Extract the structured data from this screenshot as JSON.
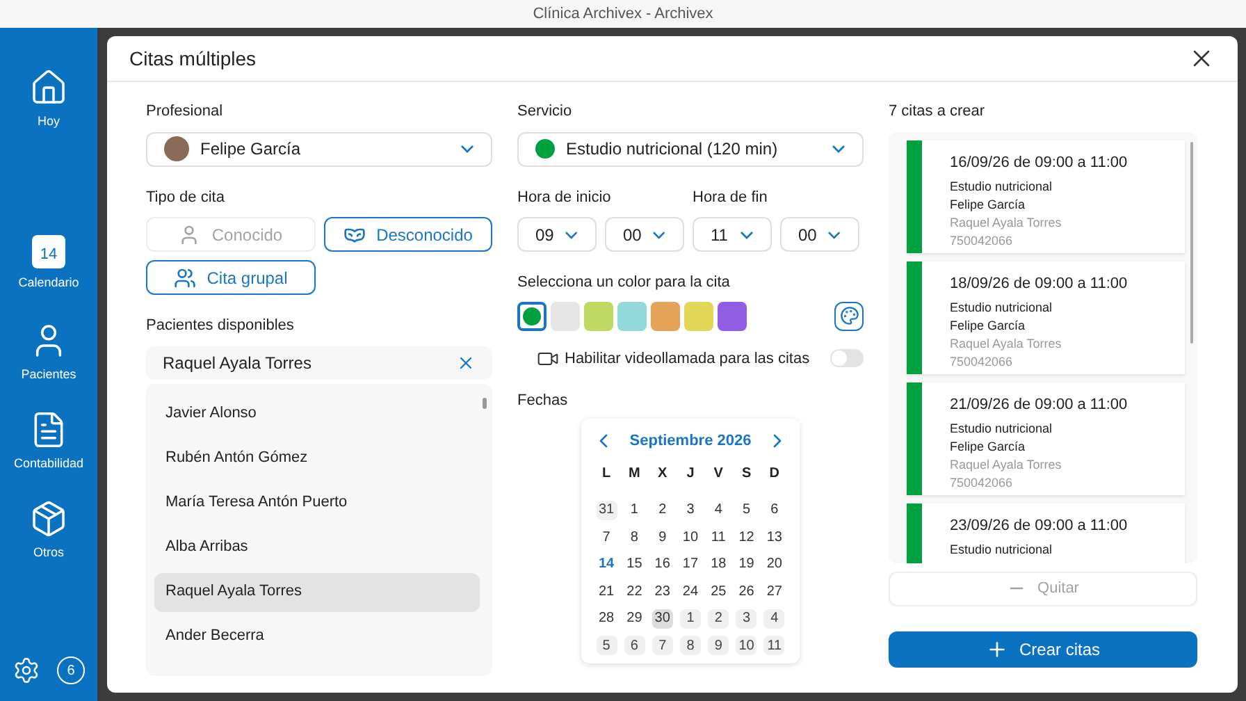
{
  "window": {
    "title": "Clínica Archivex - Archivex"
  },
  "sidebar": {
    "items": [
      {
        "label": "Hoy",
        "kind": "home"
      },
      {
        "label": "Calendario",
        "kind": "calendar",
        "icon_text": "14"
      },
      {
        "label": "Pacientes",
        "kind": "person"
      },
      {
        "label": "Contabilidad",
        "kind": "invoice"
      },
      {
        "label": "Otros",
        "kind": "box"
      }
    ],
    "badge": "6"
  },
  "dialog": {
    "title": "Citas múltiples",
    "professional": {
      "label": "Profesional",
      "value": "Felipe García"
    },
    "appointment_type": {
      "label": "Tipo de cita",
      "options": [
        {
          "label": "Conocido",
          "kind": "person",
          "disabled": true
        },
        {
          "label": "Desconocido",
          "kind": "incognito",
          "disabled": false
        },
        {
          "label": "Cita grupal",
          "kind": "group",
          "disabled": false
        }
      ]
    },
    "patients": {
      "label": "Pacientes disponibles",
      "search_value": "Raquel Ayala Torres",
      "items": [
        {
          "name": "Javier Alonso",
          "selected": false
        },
        {
          "name": "Rubén Antón Gómez",
          "selected": false
        },
        {
          "name": "María Teresa Antón Puerto",
          "selected": false
        },
        {
          "name": "Alba Arribas",
          "selected": false
        },
        {
          "name": "Raquel Ayala Torres",
          "selected": true
        },
        {
          "name": "Ander Becerra",
          "selected": false
        }
      ]
    },
    "service": {
      "label": "Servicio",
      "value": "Estudio nutricional (120 min)",
      "color": "#00a040"
    },
    "start_time": {
      "label": "Hora de inicio",
      "hour": "09",
      "minute": "00"
    },
    "end_time": {
      "label": "Hora de fin",
      "hour": "11",
      "minute": "00"
    },
    "color_picker": {
      "label": "Selecciona un color para la cita",
      "swatches": [
        {
          "color": "#00a040",
          "selected": true
        },
        {
          "color": "#e6e6e6",
          "selected": false
        },
        {
          "color": "#bfd963",
          "selected": false
        },
        {
          "color": "#93d9db",
          "selected": false
        },
        {
          "color": "#e5a35a",
          "selected": false
        },
        {
          "color": "#e3d75a",
          "selected": false
        },
        {
          "color": "#915de3",
          "selected": false
        }
      ]
    },
    "video_call": {
      "label": "Habilitar videollamada para las citas",
      "on": false
    },
    "dates": {
      "label": "Fechas",
      "month": "Septiembre 2026",
      "weekdays": [
        "L",
        "M",
        "X",
        "J",
        "V",
        "S",
        "D"
      ],
      "days": [
        {
          "label": "31",
          "kind": "outside"
        },
        {
          "label": "1",
          "kind": "normal"
        },
        {
          "label": "2",
          "kind": "normal"
        },
        {
          "label": "3",
          "kind": "normal"
        },
        {
          "label": "4",
          "kind": "normal"
        },
        {
          "label": "5",
          "kind": "normal"
        },
        {
          "label": "6",
          "kind": "normal"
        },
        {
          "label": "7",
          "kind": "normal"
        },
        {
          "label": "8",
          "kind": "normal"
        },
        {
          "label": "9",
          "kind": "normal"
        },
        {
          "label": "10",
          "kind": "normal"
        },
        {
          "label": "11",
          "kind": "normal"
        },
        {
          "label": "12",
          "kind": "normal"
        },
        {
          "label": "13",
          "kind": "normal"
        },
        {
          "label": "14",
          "kind": "today"
        },
        {
          "label": "15",
          "kind": "normal"
        },
        {
          "label": "16",
          "kind": "normal"
        },
        {
          "label": "17",
          "kind": "normal"
        },
        {
          "label": "18",
          "kind": "normal"
        },
        {
          "label": "19",
          "kind": "normal"
        },
        {
          "label": "20",
          "kind": "normal"
        },
        {
          "label": "21",
          "kind": "normal"
        },
        {
          "label": "22",
          "kind": "normal"
        },
        {
          "label": "23",
          "kind": "normal"
        },
        {
          "label": "24",
          "kind": "normal"
        },
        {
          "label": "25",
          "kind": "normal"
        },
        {
          "label": "26",
          "kind": "normal"
        },
        {
          "label": "27",
          "kind": "normal"
        },
        {
          "label": "28",
          "kind": "normal"
        },
        {
          "label": "29",
          "kind": "normal"
        },
        {
          "label": "30",
          "kind": "highlighted"
        },
        {
          "label": "1",
          "kind": "outside"
        },
        {
          "label": "2",
          "kind": "outside"
        },
        {
          "label": "3",
          "kind": "outside"
        },
        {
          "label": "4",
          "kind": "outside"
        },
        {
          "label": "5",
          "kind": "outside"
        },
        {
          "label": "6",
          "kind": "outside"
        },
        {
          "label": "7",
          "kind": "outside"
        },
        {
          "label": "8",
          "kind": "outside"
        },
        {
          "label": "9",
          "kind": "outside"
        },
        {
          "label": "10",
          "kind": "outside"
        },
        {
          "label": "11",
          "kind": "outside"
        }
      ]
    },
    "appointments": {
      "label": "7 citas a crear",
      "items": [
        {
          "when": "16/09/26 de 09:00 a 11:00",
          "service": "Estudio nutricional",
          "professional": "Felipe García",
          "patient": "Raquel Ayala Torres",
          "phone": "750042066",
          "color": "#00a040"
        },
        {
          "when": "18/09/26 de 09:00 a 11:00",
          "service": "Estudio nutricional",
          "professional": "Felipe García",
          "patient": "Raquel Ayala Torres",
          "phone": "750042066",
          "color": "#00a040"
        },
        {
          "when": "21/09/26 de 09:00 a 11:00",
          "service": "Estudio nutricional",
          "professional": "Felipe García",
          "patient": "Raquel Ayala Torres",
          "phone": "750042066",
          "color": "#00a040"
        },
        {
          "when": "23/09/26 de 09:00 a 11:00",
          "service": "Estudio nutricional",
          "color": "#00a040"
        }
      ]
    },
    "remove_button": {
      "label": "Quitar",
      "disabled": true
    },
    "create_button": {
      "label": "Crear citas"
    }
  }
}
